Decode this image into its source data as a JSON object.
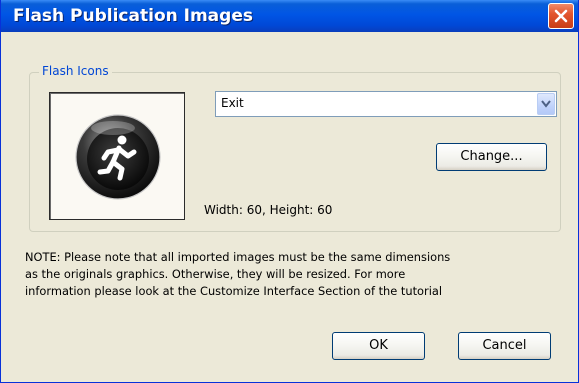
{
  "window": {
    "title": "Flash Publication Images"
  },
  "group": {
    "title": "Flash Icons"
  },
  "icon_preview": {
    "icon": "running-man-exit-icon"
  },
  "select": {
    "value": "Exit"
  },
  "buttons": {
    "change": "Change...",
    "ok": "OK",
    "cancel": "Cancel"
  },
  "dimensions_text": "Width: 60, Height: 60",
  "note_lines": [
    "NOTE: Please note that all imported images must be the same dimensions",
    "as the originals graphics. Otherwise, they will be resized. For more",
    "information please look at the Customize Interface Section of the tutorial"
  ],
  "colors": {
    "titlebar": "#0055e5",
    "group_title": "#0046d5",
    "close": "#e3562e",
    "face": "#ece9d8"
  }
}
